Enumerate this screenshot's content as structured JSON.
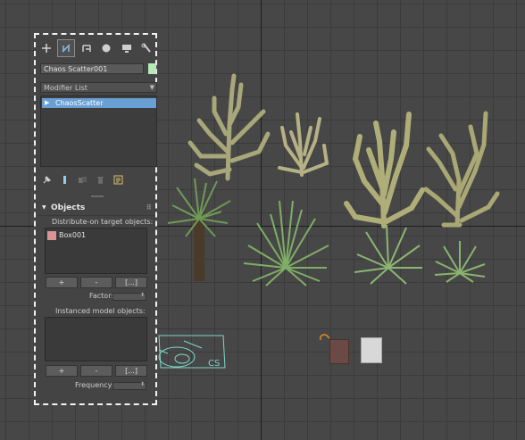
{
  "command_panel": {
    "tabs": [
      {
        "name": "create",
        "icon": "plus-icon"
      },
      {
        "name": "modify",
        "icon": "modify-icon"
      },
      {
        "name": "hierarchy",
        "icon": "hierarchy-icon"
      },
      {
        "name": "motion",
        "icon": "motion-icon"
      },
      {
        "name": "display",
        "icon": "display-icon"
      },
      {
        "name": "utilities",
        "icon": "wrench-icon"
      }
    ],
    "active_tab": "modify",
    "object_name": "Chaos Scatter001",
    "object_color": "#b8e8b8",
    "modifier_list_label": "Modifier List",
    "stack_items": [
      "ChaosScatter"
    ],
    "stack_selected_color": "#6a9fd4"
  },
  "objects_rollout": {
    "title": "Objects",
    "distribute_label": "Distribute-on target objects:",
    "target_objects": [
      {
        "name": "Box001",
        "color": "#d99595"
      }
    ],
    "add_label": "+",
    "remove_label": "-",
    "pick_list_label": "[...]",
    "factor_label": "Factor:",
    "instanced_label": "Instanced model objects:",
    "instanced_objects": [],
    "add2_label": "+",
    "remove2_label": "-",
    "pick_list2_label": "[...]",
    "frequency_label": "Frequency:"
  },
  "viewport": {
    "gizmo_label": "CS",
    "grid_color": "#3b3b3b",
    "background": "#474747"
  }
}
